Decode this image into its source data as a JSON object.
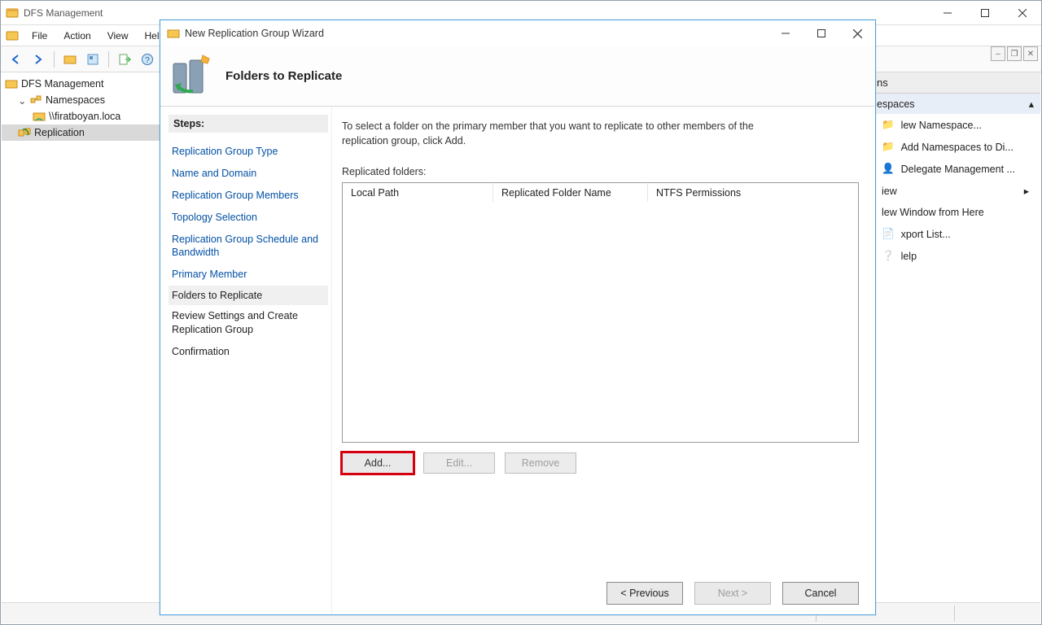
{
  "app": {
    "title": "DFS Management"
  },
  "menu": {
    "file": "File",
    "action": "Action",
    "view": "View",
    "help": "Help"
  },
  "tree": {
    "root": "DFS Management",
    "namespaces": "Namespaces",
    "ns_item": "\\\\firatboyan.loca",
    "replication": "Replication"
  },
  "actions": {
    "header": "ns",
    "sub": "espaces",
    "items": {
      "new_ns": "lew Namespace...",
      "add_ns": "Add Namespaces to Di...",
      "delegate": "Delegate Management ...",
      "view": "iew",
      "new_window": "lew Window from Here",
      "export": "xport List...",
      "help": "lelp"
    }
  },
  "wizard": {
    "title": "New Replication Group Wizard",
    "heading": "Folders to Replicate",
    "steps_label": "Steps:",
    "steps": {
      "type": "Replication Group Type",
      "name": "Name and Domain",
      "members": "Replication Group Members",
      "topology": "Topology Selection",
      "schedule": "Replication Group Schedule and Bandwidth",
      "primary": "Primary Member",
      "folders": "Folders to Replicate",
      "review": "Review Settings and Create Replication Group",
      "confirm": "Confirmation"
    },
    "intro": "To select a folder on the primary member that you want to replicate to other members of the replication group, click Add.",
    "list_label": "Replicated folders:",
    "cols": {
      "path": "Local Path",
      "name": "Replicated Folder Name",
      "ntfs": "NTFS Permissions"
    },
    "buttons": {
      "add": "Add...",
      "edit": "Edit...",
      "remove": "Remove"
    },
    "nav": {
      "prev": "< Previous",
      "next": "Next >",
      "cancel": "Cancel"
    }
  }
}
